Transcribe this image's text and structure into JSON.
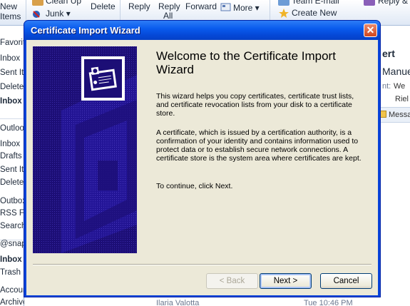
{
  "ribbon": {
    "new_label_1": "New",
    "new_label_2": "Items",
    "cleanup_label": "Clean Up",
    "junk_label": "Junk",
    "delete_label": "Delete",
    "reply_label": "Reply",
    "reply_all_label_1": "Reply",
    "reply_all_label_2": "All",
    "forward_label": "Forward",
    "more_label": "More",
    "team_email_label": "Team E-mail",
    "create_new_label": "Create New",
    "reply_delete_label": "Reply & Del"
  },
  "nav": {
    "items": [
      "Favorites",
      "Inbox",
      "Sent Items",
      "Deleted",
      "Inbox (",
      "Outlook Data",
      "Inbox",
      "Drafts",
      "Sent Items",
      "Deleted",
      "Outbox",
      "RSS Feeds",
      "Search",
      "@snap",
      "Inbox (",
      "Trash",
      "Account",
      "Archive"
    ]
  },
  "message_list": {
    "sender": "Ilaria Valotta",
    "time": "Tue 10:46 PM"
  },
  "reading": {
    "title": "ert",
    "from": "Manuel",
    "sent_label": "nt:",
    "sent_value": "We",
    "to_value": "Riel",
    "bar_label": "Messa"
  },
  "dialog": {
    "title": "Certificate Import Wizard",
    "close_glyph": "✕",
    "heading": "Welcome to the Certificate Import Wizard",
    "para1": "This wizard helps you copy certificates, certificate trust lists, and certificate revocation lists from your disk to a certificate store.",
    "para2": "A certificate, which is issued by a certification authority, is a confirmation of your identity and contains information used to protect data or to establish secure network connections. A certificate store is the system area where certificates are kept.",
    "para3": "To continue, click Next.",
    "back_label": "< Back",
    "next_label": "Next >",
    "cancel_label": "Cancel"
  },
  "colors": {
    "titlebar": "#0a5cee",
    "dialog_face": "#ece9d8",
    "panel": "#1c0e76",
    "close": "#d2461c"
  }
}
